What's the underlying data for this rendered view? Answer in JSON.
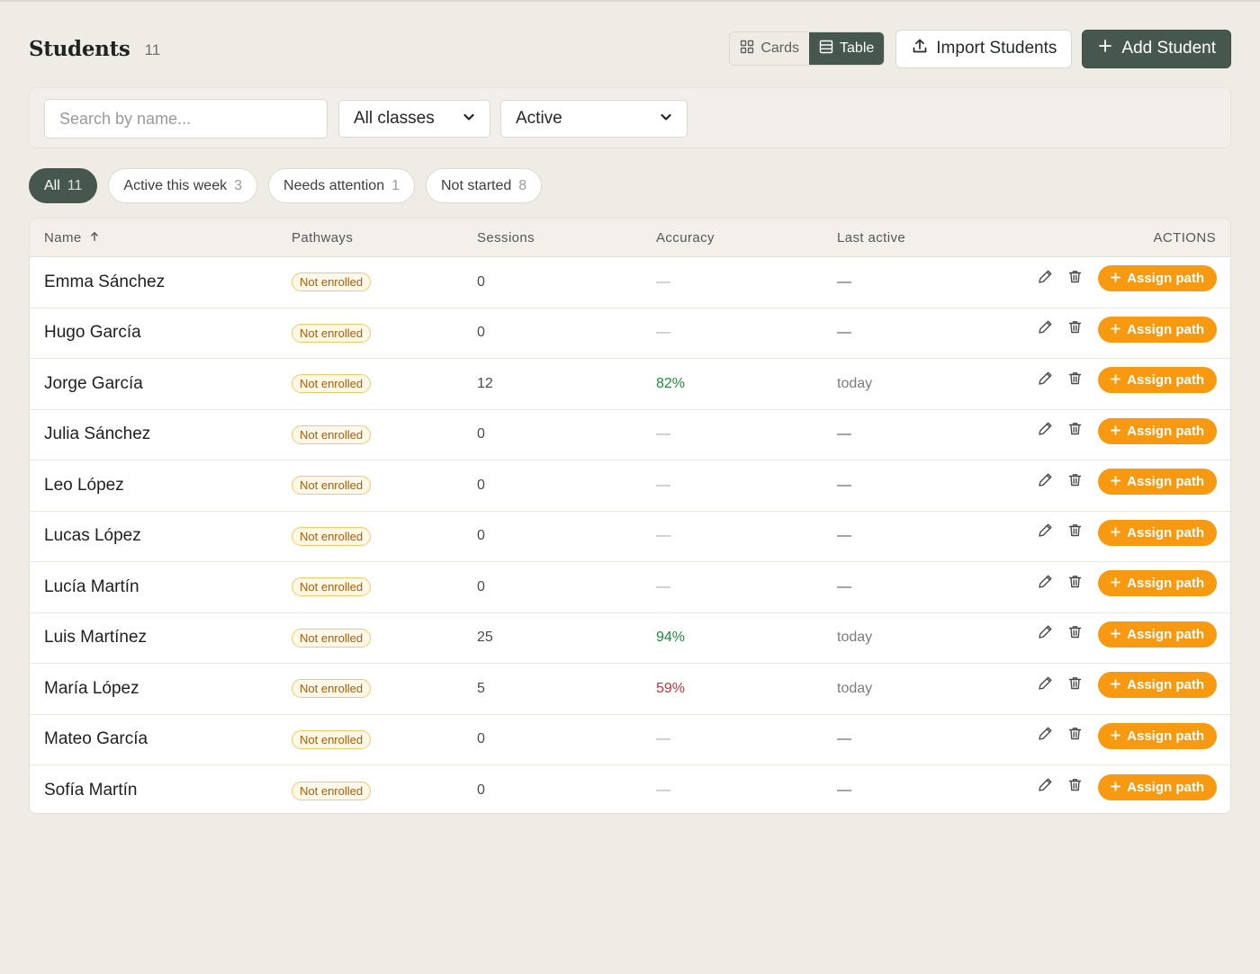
{
  "header": {
    "title": "Students",
    "count": "11",
    "view_cards": "Cards",
    "view_table": "Table",
    "import_label": "Import Students",
    "add_label": "Add Student"
  },
  "filters": {
    "search_placeholder": "Search by name...",
    "class_value": "All classes",
    "status_value": "Active"
  },
  "chips": [
    {
      "label": "All",
      "count": "11"
    },
    {
      "label": "Active this week",
      "count": "3"
    },
    {
      "label": "Needs attention",
      "count": "1"
    },
    {
      "label": "Not started",
      "count": "8"
    }
  ],
  "table": {
    "columns": {
      "name": "Name",
      "pathways": "Pathways",
      "sessions": "Sessions",
      "accuracy": "Accuracy",
      "last_active": "Last active",
      "actions": "ACTIONS"
    },
    "assign_label": "Assign path",
    "rows": [
      {
        "name": "Emma Sánchez",
        "pathway": "Not enrolled",
        "sessions": "0",
        "accuracy": "—",
        "last_active": "—"
      },
      {
        "name": "Hugo García",
        "pathway": "Not enrolled",
        "sessions": "0",
        "accuracy": "—",
        "last_active": "—"
      },
      {
        "name": "Jorge García",
        "pathway": "Not enrolled",
        "sessions": "12",
        "accuracy": "82%",
        "last_active": "today"
      },
      {
        "name": "Julia Sánchez",
        "pathway": "Not enrolled",
        "sessions": "0",
        "accuracy": "—",
        "last_active": "—"
      },
      {
        "name": "Leo López",
        "pathway": "Not enrolled",
        "sessions": "0",
        "accuracy": "—",
        "last_active": "—"
      },
      {
        "name": "Lucas López",
        "pathway": "Not enrolled",
        "sessions": "0",
        "accuracy": "—",
        "last_active": "—"
      },
      {
        "name": "Lucía Martín",
        "pathway": "Not enrolled",
        "sessions": "0",
        "accuracy": "—",
        "last_active": "—"
      },
      {
        "name": "Luis Martínez",
        "pathway": "Not enrolled",
        "sessions": "25",
        "accuracy": "94%",
        "last_active": "today"
      },
      {
        "name": "María López",
        "pathway": "Not enrolled",
        "sessions": "5",
        "accuracy": "59%",
        "last_active": "today"
      },
      {
        "name": "Mateo García",
        "pathway": "Not enrolled",
        "sessions": "0",
        "accuracy": "—",
        "last_active": "—"
      },
      {
        "name": "Sofía Martín",
        "pathway": "Not enrolled",
        "sessions": "0",
        "accuracy": "—",
        "last_active": "—"
      }
    ]
  },
  "colors": {
    "primary": "#46574f",
    "accent": "#f79a12",
    "accuracy_good": "#1f8a3e",
    "accuracy_bad": "#d02c3c",
    "background": "#efece6"
  }
}
